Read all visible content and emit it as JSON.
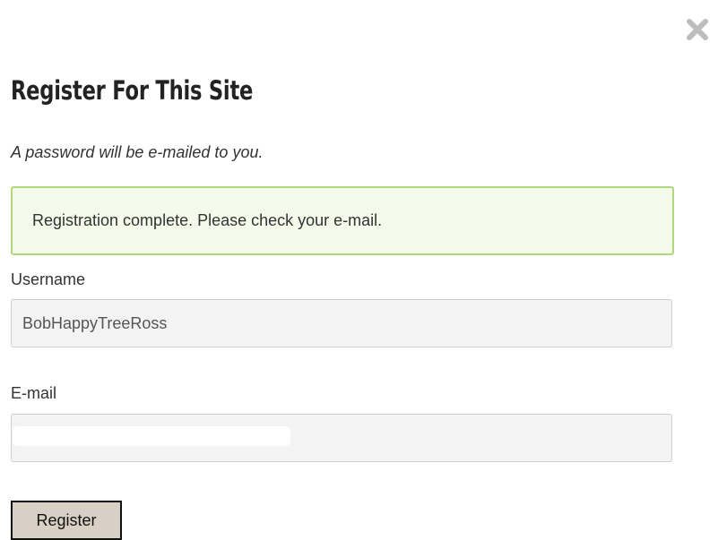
{
  "modal": {
    "close_icon": "close-x-icon",
    "title": "Register For This Site",
    "subtitle": "A password will be e-mailed to you.",
    "success_message": "Registration complete. Please check your e-mail."
  },
  "form": {
    "username_label": "Username",
    "username_value": "BobHappyTreeRoss",
    "email_label": "E-mail",
    "email_value": "",
    "submit_label": "Register"
  },
  "colors": {
    "success_border": "#b1d77c",
    "success_background": "#f4fbea",
    "close_icon": "#bdbdbd",
    "button_background": "#d8d0c4"
  }
}
